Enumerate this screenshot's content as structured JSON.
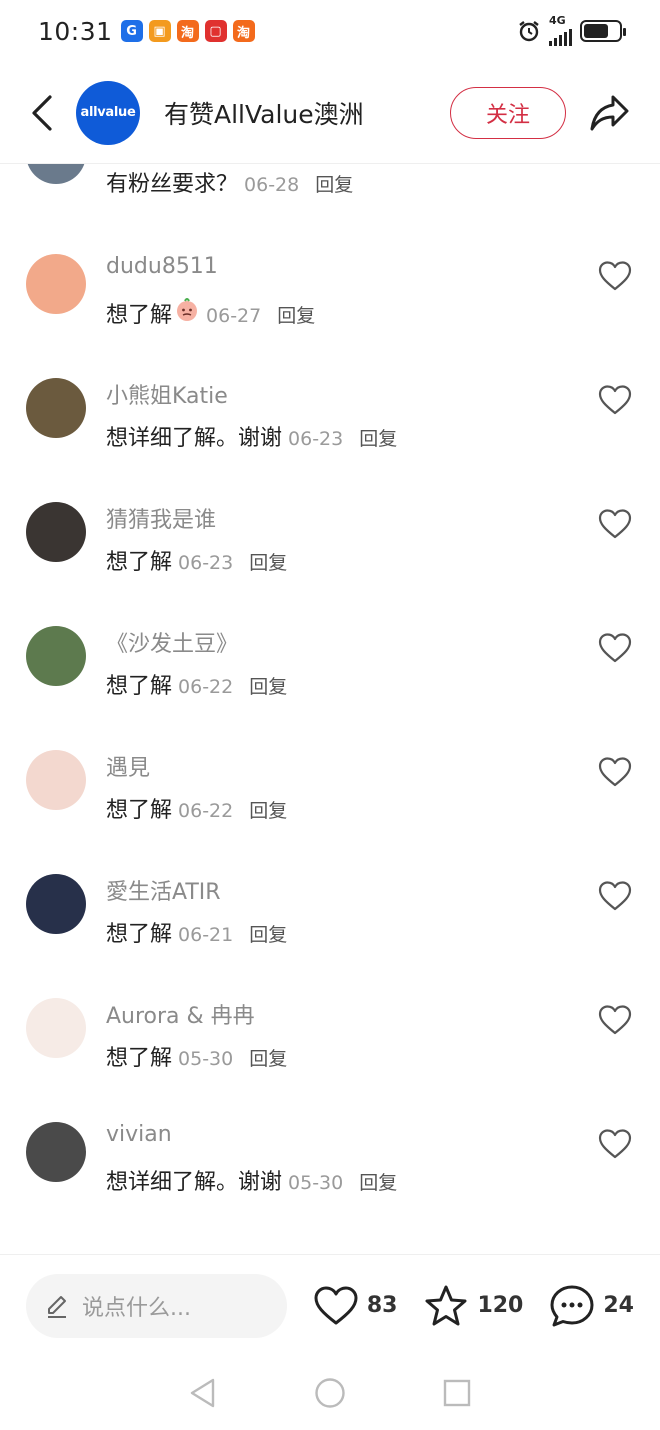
{
  "status_bar": {
    "time": "10:31",
    "apps": [
      {
        "name": "g-app-icon",
        "glyph": "G",
        "color": "#1e6fe8"
      },
      {
        "name": "gift-app-icon",
        "glyph": "▣",
        "color": "#f39a1e"
      },
      {
        "name": "taobao-app-icon-1",
        "glyph": "淘",
        "color": "#f36a1c"
      },
      {
        "name": "red-app-icon",
        "glyph": "▢",
        "color": "#e0312f"
      },
      {
        "name": "taobao-app-icon-2",
        "glyph": "淘",
        "color": "#f36a1c"
      }
    ],
    "network": "4G"
  },
  "header": {
    "logo_text": "allvalue",
    "title": "有赞AllValue澳洲",
    "follow_label": "关注"
  },
  "comments": [
    {
      "username": "",
      "text": "有粉丝要求？",
      "date": "06-28",
      "reply": "回复",
      "avatar_color": "#6a7a8c",
      "partial": true
    },
    {
      "username": "dudu8511",
      "text": "想了解",
      "emoji": true,
      "date": "06-27",
      "reply": "回复",
      "avatar_color": "#f2a98a"
    },
    {
      "username": "小熊姐Katie",
      "text": "想详细了解。谢谢",
      "date": "06-23",
      "reply": "回复",
      "avatar_color": "#6b5a3e"
    },
    {
      "username": "猜猜我是谁",
      "text": "想了解",
      "date": "06-23",
      "reply": "回复",
      "avatar_color": "#3a3532"
    },
    {
      "username": "《沙发土豆》",
      "text": "想了解",
      "date": "06-22",
      "reply": "回复",
      "avatar_color": "#5d7a4e"
    },
    {
      "username": "遇見",
      "text": "想了解",
      "date": "06-22",
      "reply": "回复",
      "avatar_color": "#f3d8cf"
    },
    {
      "username": "愛生活ATIR",
      "text": "想了解",
      "date": "06-21",
      "reply": "回复",
      "avatar_color": "#27304a"
    },
    {
      "username": "Aurora & 冉冉",
      "text": "想了解",
      "date": "05-30",
      "reply": "回复",
      "avatar_color": "#f6ebe6"
    },
    {
      "username": "vivian",
      "text": "想详细了解。谢谢",
      "date": "05-30",
      "reply": "回复",
      "avatar_color": "#4a4a4a"
    }
  ],
  "bottom_bar": {
    "input_placeholder": "说点什么...",
    "likes": "83",
    "stars": "120",
    "comments": "24"
  }
}
